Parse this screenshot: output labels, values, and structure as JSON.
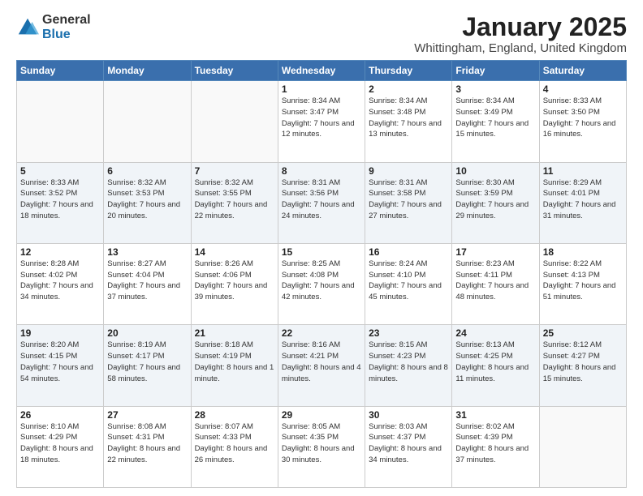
{
  "logo": {
    "general": "General",
    "blue": "Blue"
  },
  "title": {
    "month_year": "January 2025",
    "location": "Whittingham, England, United Kingdom"
  },
  "weekdays": [
    "Sunday",
    "Monday",
    "Tuesday",
    "Wednesday",
    "Thursday",
    "Friday",
    "Saturday"
  ],
  "weeks": [
    [
      {
        "day": "",
        "sunrise": "",
        "sunset": "",
        "daylight": ""
      },
      {
        "day": "",
        "sunrise": "",
        "sunset": "",
        "daylight": ""
      },
      {
        "day": "",
        "sunrise": "",
        "sunset": "",
        "daylight": ""
      },
      {
        "day": "1",
        "sunrise": "Sunrise: 8:34 AM",
        "sunset": "Sunset: 3:47 PM",
        "daylight": "Daylight: 7 hours and 12 minutes."
      },
      {
        "day": "2",
        "sunrise": "Sunrise: 8:34 AM",
        "sunset": "Sunset: 3:48 PM",
        "daylight": "Daylight: 7 hours and 13 minutes."
      },
      {
        "day": "3",
        "sunrise": "Sunrise: 8:34 AM",
        "sunset": "Sunset: 3:49 PM",
        "daylight": "Daylight: 7 hours and 15 minutes."
      },
      {
        "day": "4",
        "sunrise": "Sunrise: 8:33 AM",
        "sunset": "Sunset: 3:50 PM",
        "daylight": "Daylight: 7 hours and 16 minutes."
      }
    ],
    [
      {
        "day": "5",
        "sunrise": "Sunrise: 8:33 AM",
        "sunset": "Sunset: 3:52 PM",
        "daylight": "Daylight: 7 hours and 18 minutes."
      },
      {
        "day": "6",
        "sunrise": "Sunrise: 8:32 AM",
        "sunset": "Sunset: 3:53 PM",
        "daylight": "Daylight: 7 hours and 20 minutes."
      },
      {
        "day": "7",
        "sunrise": "Sunrise: 8:32 AM",
        "sunset": "Sunset: 3:55 PM",
        "daylight": "Daylight: 7 hours and 22 minutes."
      },
      {
        "day": "8",
        "sunrise": "Sunrise: 8:31 AM",
        "sunset": "Sunset: 3:56 PM",
        "daylight": "Daylight: 7 hours and 24 minutes."
      },
      {
        "day": "9",
        "sunrise": "Sunrise: 8:31 AM",
        "sunset": "Sunset: 3:58 PM",
        "daylight": "Daylight: 7 hours and 27 minutes."
      },
      {
        "day": "10",
        "sunrise": "Sunrise: 8:30 AM",
        "sunset": "Sunset: 3:59 PM",
        "daylight": "Daylight: 7 hours and 29 minutes."
      },
      {
        "day": "11",
        "sunrise": "Sunrise: 8:29 AM",
        "sunset": "Sunset: 4:01 PM",
        "daylight": "Daylight: 7 hours and 31 minutes."
      }
    ],
    [
      {
        "day": "12",
        "sunrise": "Sunrise: 8:28 AM",
        "sunset": "Sunset: 4:02 PM",
        "daylight": "Daylight: 7 hours and 34 minutes."
      },
      {
        "day": "13",
        "sunrise": "Sunrise: 8:27 AM",
        "sunset": "Sunset: 4:04 PM",
        "daylight": "Daylight: 7 hours and 37 minutes."
      },
      {
        "day": "14",
        "sunrise": "Sunrise: 8:26 AM",
        "sunset": "Sunset: 4:06 PM",
        "daylight": "Daylight: 7 hours and 39 minutes."
      },
      {
        "day": "15",
        "sunrise": "Sunrise: 8:25 AM",
        "sunset": "Sunset: 4:08 PM",
        "daylight": "Daylight: 7 hours and 42 minutes."
      },
      {
        "day": "16",
        "sunrise": "Sunrise: 8:24 AM",
        "sunset": "Sunset: 4:10 PM",
        "daylight": "Daylight: 7 hours and 45 minutes."
      },
      {
        "day": "17",
        "sunrise": "Sunrise: 8:23 AM",
        "sunset": "Sunset: 4:11 PM",
        "daylight": "Daylight: 7 hours and 48 minutes."
      },
      {
        "day": "18",
        "sunrise": "Sunrise: 8:22 AM",
        "sunset": "Sunset: 4:13 PM",
        "daylight": "Daylight: 7 hours and 51 minutes."
      }
    ],
    [
      {
        "day": "19",
        "sunrise": "Sunrise: 8:20 AM",
        "sunset": "Sunset: 4:15 PM",
        "daylight": "Daylight: 7 hours and 54 minutes."
      },
      {
        "day": "20",
        "sunrise": "Sunrise: 8:19 AM",
        "sunset": "Sunset: 4:17 PM",
        "daylight": "Daylight: 7 hours and 58 minutes."
      },
      {
        "day": "21",
        "sunrise": "Sunrise: 8:18 AM",
        "sunset": "Sunset: 4:19 PM",
        "daylight": "Daylight: 8 hours and 1 minute."
      },
      {
        "day": "22",
        "sunrise": "Sunrise: 8:16 AM",
        "sunset": "Sunset: 4:21 PM",
        "daylight": "Daylight: 8 hours and 4 minutes."
      },
      {
        "day": "23",
        "sunrise": "Sunrise: 8:15 AM",
        "sunset": "Sunset: 4:23 PM",
        "daylight": "Daylight: 8 hours and 8 minutes."
      },
      {
        "day": "24",
        "sunrise": "Sunrise: 8:13 AM",
        "sunset": "Sunset: 4:25 PM",
        "daylight": "Daylight: 8 hours and 11 minutes."
      },
      {
        "day": "25",
        "sunrise": "Sunrise: 8:12 AM",
        "sunset": "Sunset: 4:27 PM",
        "daylight": "Daylight: 8 hours and 15 minutes."
      }
    ],
    [
      {
        "day": "26",
        "sunrise": "Sunrise: 8:10 AM",
        "sunset": "Sunset: 4:29 PM",
        "daylight": "Daylight: 8 hours and 18 minutes."
      },
      {
        "day": "27",
        "sunrise": "Sunrise: 8:08 AM",
        "sunset": "Sunset: 4:31 PM",
        "daylight": "Daylight: 8 hours and 22 minutes."
      },
      {
        "day": "28",
        "sunrise": "Sunrise: 8:07 AM",
        "sunset": "Sunset: 4:33 PM",
        "daylight": "Daylight: 8 hours and 26 minutes."
      },
      {
        "day": "29",
        "sunrise": "Sunrise: 8:05 AM",
        "sunset": "Sunset: 4:35 PM",
        "daylight": "Daylight: 8 hours and 30 minutes."
      },
      {
        "day": "30",
        "sunrise": "Sunrise: 8:03 AM",
        "sunset": "Sunset: 4:37 PM",
        "daylight": "Daylight: 8 hours and 34 minutes."
      },
      {
        "day": "31",
        "sunrise": "Sunrise: 8:02 AM",
        "sunset": "Sunset: 4:39 PM",
        "daylight": "Daylight: 8 hours and 37 minutes."
      },
      {
        "day": "",
        "sunrise": "",
        "sunset": "",
        "daylight": ""
      }
    ]
  ]
}
